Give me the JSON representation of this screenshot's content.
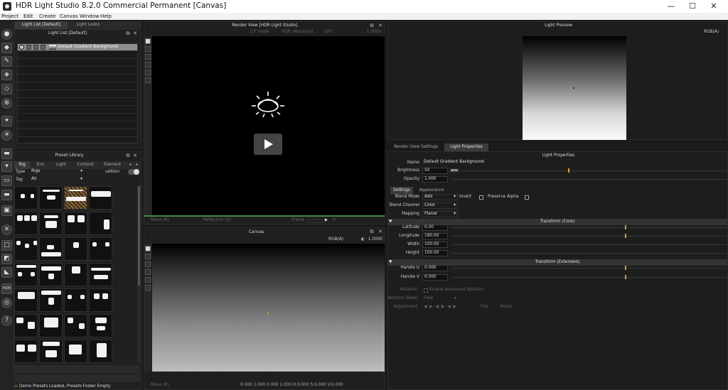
{
  "window": {
    "title": "HDR Light Studio 8.2.0  Commercial Permanent [Canvas]",
    "controls": [
      "—",
      "☐",
      "✕"
    ]
  },
  "menu": [
    "Project",
    "Edit",
    "Create",
    "Canvas",
    "Window",
    "Help"
  ],
  "toolbar": {
    "icons": [
      "sphere-light-icon",
      "area-light-icon",
      "spot-light-icon",
      "light-icon",
      "stroke-light-icon",
      "ring-light-icon",
      "wand-icon",
      "sun-icon",
      "panel-icon",
      "menu-icon",
      "panel-icon-2",
      "panel-icon-3",
      "monitor-icon",
      "delete-icon",
      "square-icon",
      "cube-icon",
      "arrow-icon",
      "hdr-icon",
      "hdr-cube-icon",
      "help-icon"
    ],
    "hdr_label": "HDR",
    "help_label": "?"
  },
  "light_list": {
    "tabs": [
      "Light List [Default]",
      "Light Looks"
    ],
    "title": "Light List [Default]",
    "items": [
      {
        "name": "Default Gradient Background"
      }
    ]
  },
  "preset_library": {
    "title": "Preset Library",
    "tabs": [
      "Rig",
      "Env",
      "Light",
      "Content",
      "Element"
    ],
    "type_label": "Type",
    "type_value": "Rigs",
    "tag_label": "Tag",
    "tag_value": "All",
    "toggle_label": "udition",
    "status": "Demo Presets Loaded, Presets Folder Empty"
  },
  "render_view": {
    "title": "Render View [HDR Light Studio]",
    "dropdown_1": "LIT mode",
    "dropdown_2": "HDR (Absolute)",
    "dropdown_3": "OFF",
    "value": "1.0000",
    "bottom_dropdown_1": "Move (R)",
    "bottom_dropdown_2": "Reflection (V)",
    "bottom_label": "Frame"
  },
  "canvas": {
    "title": "Canvas",
    "channel": "RGB(A)",
    "value": "1.0000",
    "bottom_dropdown": "Move (R)",
    "readout": "0 000  1.000  0.000  1.000  H:0.000 S:0.000 V:0.000"
  },
  "light_preview": {
    "title": "Light Preview",
    "channel": "RGB(A)"
  },
  "right_tabs": [
    "Render View Settings",
    "Light Properties"
  ],
  "light_properties": {
    "title": "Light Properties",
    "name_label": "Name",
    "name_value": "Default Gradient Background",
    "brightness_label": "Brightness",
    "brightness_value": "50",
    "opacity_label": "Opacity",
    "opacity_value": "1.000",
    "subtabs": [
      "Settings",
      "Appearance"
    ],
    "blend_mode_label": "Blend Mode",
    "blend_mode_value": "Add",
    "invert_label": "Invert",
    "preserve_alpha_label": "Preserve Alpha",
    "blend_channel_label": "Blend Channel",
    "blend_channel_value": "Color",
    "mapping_label": "Mapping",
    "mapping_value": "Planar",
    "transform_core": "Transform (Core)",
    "latitude_label": "Latitude",
    "latitude_value": "0.00",
    "longitude_label": "Longitude",
    "longitude_value": "180.00",
    "width_label": "Width",
    "width_value": "100.00",
    "height_label": "Height",
    "height_value": "100.00",
    "transform_extended": "Transform (Extended)",
    "handle_u_label": "Handle U",
    "handle_u_value": "0.000",
    "handle_v_label": "Handle V",
    "handle_v_value": "0.000",
    "rotation_label": "Rotation",
    "enable_adv_label": "Enable Advanced Rotation",
    "rotation_mode_label": "Rotation Mode",
    "rotation_mode_value": "Flow",
    "adjustment_label": "Adjustment",
    "flip_label": "Flip",
    "reset_label": "Reset",
    "brightness_level": 0.4,
    "latitude_level": 0.63,
    "longitude_level": 0.63,
    "handle_u_level": 0.63,
    "handle_v_level": 0.63
  },
  "colors": {
    "accent": "#d8a12b",
    "background": "#1b1b1b",
    "panel": "#202020",
    "selected_row": "#8d8d8d"
  }
}
